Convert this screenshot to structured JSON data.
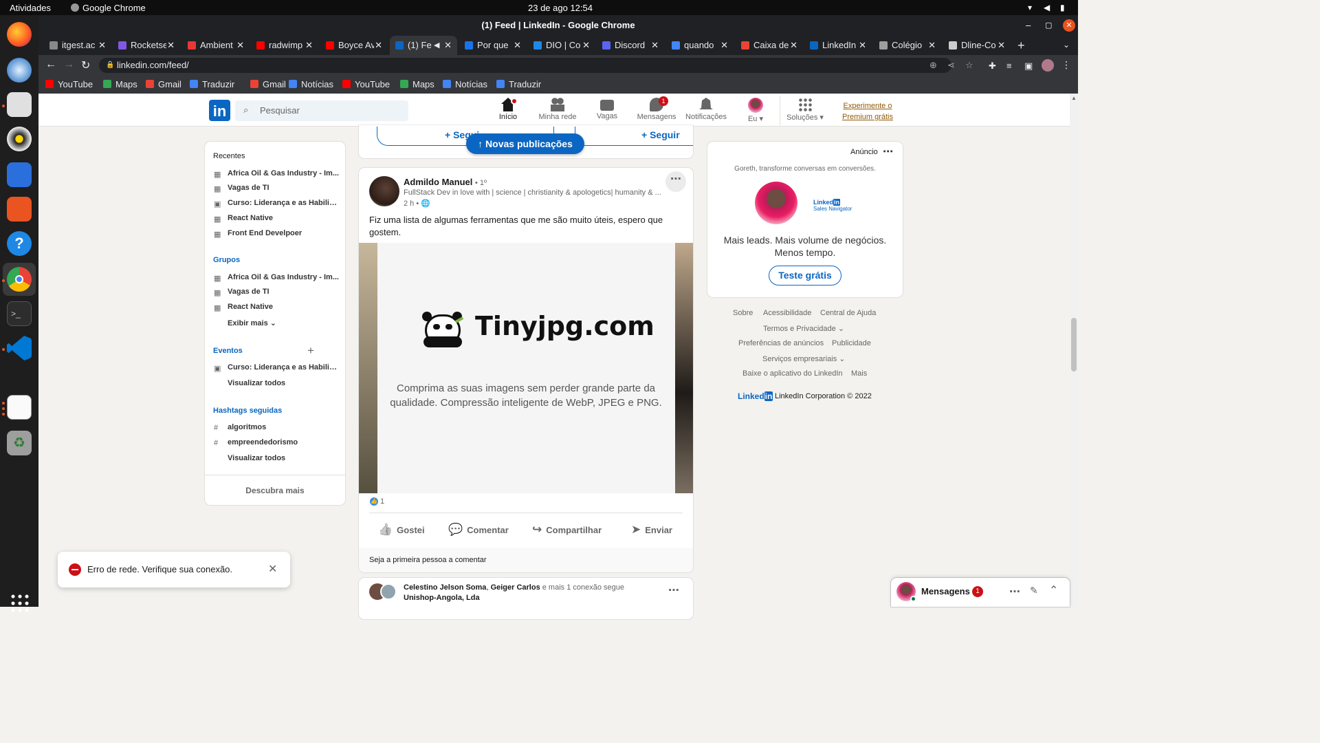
{
  "os": {
    "activities": "Atividades",
    "app_name": "Google Chrome",
    "clock": "23 de ago  12:54"
  },
  "window": {
    "title": "(1) Feed | LinkedIn - Google Chrome"
  },
  "tabs": [
    {
      "label": "itgest.ac",
      "color": "#888888"
    },
    {
      "label": "Rocketse",
      "color": "#8257e5"
    },
    {
      "label": "Ambient",
      "color": "#e53935"
    },
    {
      "label": "radwimp",
      "color": "#ff0000"
    },
    {
      "label": "Boyce Av",
      "color": "#ff0000"
    },
    {
      "label": "(1) Fe",
      "color": "#0a66c2"
    },
    {
      "label": "Por que",
      "color": "#1a73e8"
    },
    {
      "label": "DIO | Co",
      "color": "#1e88e5"
    },
    {
      "label": "Discord",
      "color": "#5865f2"
    },
    {
      "label": "quando",
      "color": "#4285f4"
    },
    {
      "label": "Caixa de",
      "color": "#ea4335"
    },
    {
      "label": "LinkedIn",
      "color": "#0a66c2"
    },
    {
      "label": "Colégio",
      "color": "#9e9e9e"
    },
    {
      "label": "Dline-Co",
      "color": "#cccccc"
    }
  ],
  "address": {
    "url": "linkedin.com/feed/"
  },
  "bookmarks": [
    {
      "label": "YouTube",
      "color": "#ff0000"
    },
    {
      "label": "Maps",
      "color": "#34a853"
    },
    {
      "label": "Gmail",
      "color": "#ea4335"
    },
    {
      "label": "Traduzir",
      "color": "#4285f4"
    },
    {
      "label": "Gmail",
      "color": "#ea4335"
    },
    {
      "label": "Notícias",
      "color": "#4285f4"
    },
    {
      "label": "YouTube",
      "color": "#ff0000"
    },
    {
      "label": "Maps",
      "color": "#34a853"
    },
    {
      "label": "Notícias",
      "color": "#4285f4"
    },
    {
      "label": "Traduzir",
      "color": "#4285f4"
    }
  ],
  "linkedin": {
    "logo": "in",
    "search_placeholder": "Pesquisar",
    "nav": [
      {
        "label": "Início",
        "icon": "home-icon",
        "badge": ""
      },
      {
        "label": "Minha rede",
        "icon": "network-icon",
        "badge": ""
      },
      {
        "label": "Vagas",
        "icon": "jobs-icon",
        "badge": ""
      },
      {
        "label": "Mensagens",
        "icon": "messaging-icon",
        "badge": "1"
      },
      {
        "label": "Notificações",
        "icon": "notifications-icon",
        "badge": ""
      },
      {
        "label": "Eu",
        "icon": "avatar",
        "badge": ""
      },
      {
        "label": "Soluções",
        "icon": "grid-icon",
        "badge": ""
      }
    ],
    "premium_line1": "Experimente o",
    "premium_line2": "Premium grátis"
  },
  "sidebar": {
    "recent_title": "Recentes",
    "recent": [
      "Africa Oil & Gas Industry - Im...",
      "Vagas de TI",
      "Curso: Liderança e as Habilid...",
      "React Native",
      "Front End Develpoer"
    ],
    "groups_title": "Grupos",
    "groups": [
      "Africa Oil & Gas Industry - Im...",
      "Vagas de TI",
      "React Native"
    ],
    "show_more": "Exibir mais",
    "events_title": "Eventos",
    "events": [
      "Curso: Liderança e as Habilid..."
    ],
    "events_view_all": "Visualizar todos",
    "hashtags_title": "Hashtags seguidas",
    "hashtags": [
      "algoritmos",
      "empreendedorismo"
    ],
    "hashtags_view_all": "Visualizar todos",
    "discover_more": "Descubra mais"
  },
  "feed": {
    "follow_label": "Seguir",
    "follow_partial": "Segui",
    "new_posts": "Novas publicações",
    "post": {
      "author": "Admildo Manuel",
      "degree": "• 1º",
      "headline": "FullStack Dev in love with | science | christianity & apologetics| humanity & ...",
      "time": "2 h •",
      "text": "Fiz uma lista de algumas ferramentas que me são muito úteis, espero que gostem.",
      "image_title": "Tinyjpg.com",
      "image_caption_1": "Comprima as suas imagens sem perder grande parte da",
      "image_caption_2": "qualidade. Compressão inteligente de WebP, JPEG e PNG.",
      "reactions": "1",
      "actions": [
        "Gostei",
        "Comentar",
        "Compartilhar",
        "Enviar"
      ],
      "first_comment": "Seja a primeira pessoa a comentar"
    },
    "next_post": {
      "name1": "Celestino Jelson Soma",
      "sep": ", ",
      "name2": "Geiger Carlos",
      "middle": " e mais 1 conexão segue ",
      "company": "Unishop-Angola, Lda"
    }
  },
  "ad": {
    "label": "Anúncio",
    "tagline": "Goreth, transforme conversas em conversões.",
    "brand": "Linked",
    "brand_in": "in",
    "brand_sub": "Sales Navigator",
    "headline_1": "Mais leads. Mais volume de negócios.",
    "headline_2": "Menos tempo.",
    "cta": "Teste grátis"
  },
  "footer": {
    "links_row1": [
      "Sobre",
      "Acessibilidade",
      "Central de Ajuda"
    ],
    "terms": "Termos e Privacidade",
    "links_row3": [
      "Preferências de anúncios",
      "Publicidade"
    ],
    "business": "Serviços empresariais",
    "links_row5": [
      "Baixe o aplicativo do LinkedIn",
      "Mais"
    ],
    "brand": "Linked",
    "brand_in": "in",
    "copyright": "LinkedIn Corporation © 2022"
  },
  "toast": {
    "message": "Erro de rede. Verifique sua conexão."
  },
  "messaging": {
    "label": "Mensagens",
    "badge": "1"
  }
}
